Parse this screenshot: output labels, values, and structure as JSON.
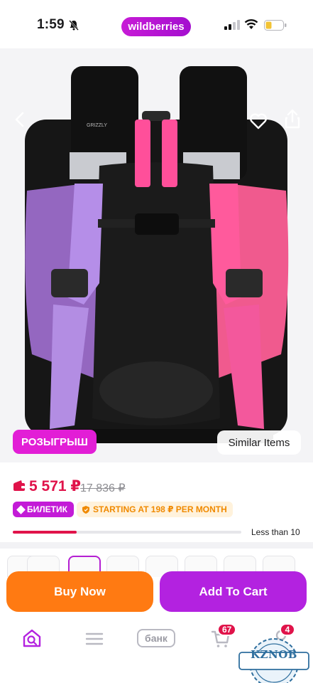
{
  "status_bar": {
    "time": "1:59",
    "brand": "wildberries",
    "icons": [
      "bell-off-icon",
      "signal-icon",
      "wifi-icon",
      "battery-icon"
    ]
  },
  "product": {
    "image_icon": "backpack-photo",
    "badge_raffle": "РОЗЫГРЫШ",
    "similar_items": "Similar Items",
    "price": "5 571 ₽",
    "old_price": "17 836 ₽",
    "ticket_badge": "БИЛЕТИК",
    "installment_badge": "STARTING AT 198 ₽ PER MONTH",
    "stock_label": "Less than 10",
    "stock_fraction": 0.28
  },
  "actions": {
    "buy_now": "Buy Now",
    "add_to_cart": "Add To Cart"
  },
  "bottom_nav": {
    "items": [
      "home-search-icon",
      "catalog-icon",
      "bank-icon",
      "cart-icon",
      "profile-icon"
    ],
    "bank_label": "банк",
    "cart_count": "67",
    "profile_count": "4"
  },
  "watermark": {
    "text": "KZNOB"
  },
  "colors": {
    "brand": "#b322e0",
    "buy": "#ff7a12",
    "price": "#e0134a"
  }
}
